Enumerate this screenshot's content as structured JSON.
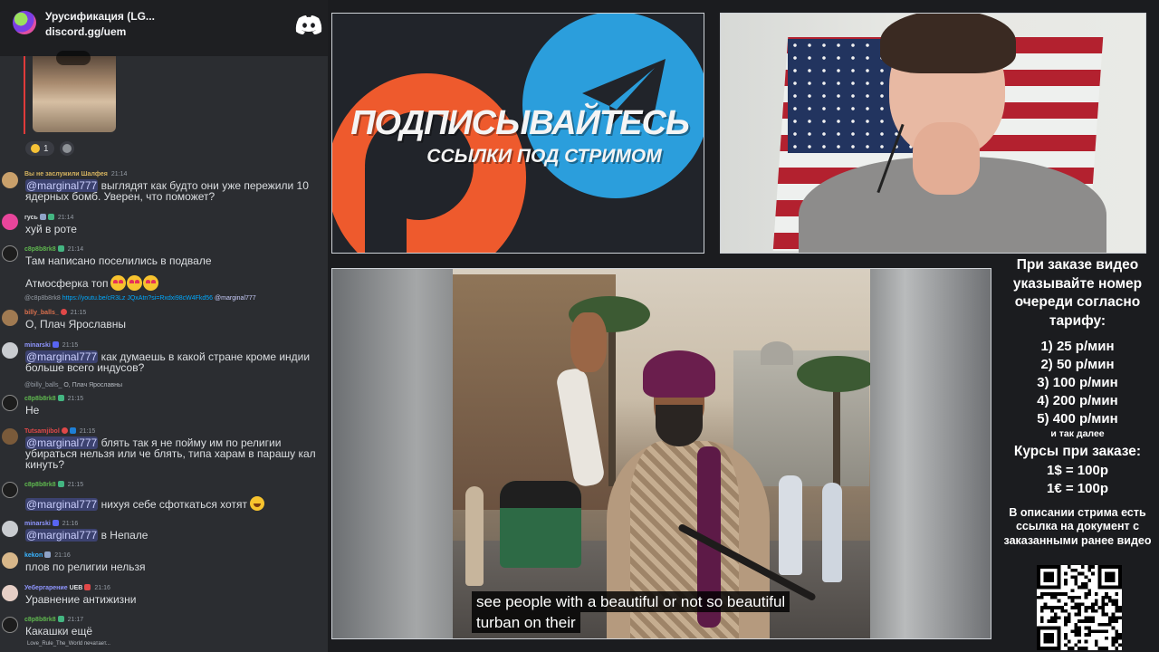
{
  "discord": {
    "server_name": "Урусификация (LG...",
    "invite": "discord.gg/uem",
    "reactions": [
      {
        "count": "1"
      }
    ],
    "messages": [
      {
        "user": "Вы не заслужили Шалфея",
        "time": "21:14",
        "user_color": "#d4b25f",
        "avatar_color": "#c9a06b",
        "text_mention": "@marginal777",
        "text": "выглядят как будто они уже пережили 10 ядерных бомб. Уверен, что поможет?"
      },
      {
        "user": "гусь",
        "time": "21:14",
        "user_color": "#dbdee1",
        "avatar_color": "#e8459b",
        "text": "хуй в роте"
      },
      {
        "user": "c8p8b8rk8",
        "time": "21:14",
        "user_color": "#5fb84f",
        "avatar_color": "#1d1d1d",
        "text": "Там написано поселились в подвале",
        "text2": "Атмосферка топ"
      },
      {
        "reply_user": "@c8p8b8rk8",
        "reply_link": "https://youtu.be/cR3Lz JQxAtn?si=Rxdxi98cW4Fkd56",
        "reply_mention": "@marginal777",
        "user": "billy_balls_",
        "time": "21:15",
        "user_color": "#d9704d",
        "avatar_color": "#a07a52",
        "text": "О, Плач Ярославны"
      },
      {
        "user": "minarski",
        "time": "21:15",
        "user_color": "#8f96ff",
        "avatar_color": "#c9ccd0",
        "text_mention": "@marginal777",
        "text": "как думаешь в какой стране кроме индии больше всего индусов?"
      },
      {
        "reply_user": "@billy_balls_",
        "reply_text": "О, Плач Ярославны",
        "user": "c8p8b8rk8",
        "time": "21:15",
        "user_color": "#5fb84f",
        "avatar_color": "#1d1d1d",
        "text": "Не"
      },
      {
        "user": "Tutsamjibol",
        "time": "21:15",
        "user_color": "#e04848",
        "avatar_color": "#7a5a3a",
        "text_mention": "@marginal777",
        "text": "блять так я не пойму им по религии убираться нельзя или че блять, типа харам в парашу кал кинуть?"
      },
      {
        "user": "c8p8b8rk8",
        "time": "21:15",
        "user_color": "#5fb84f",
        "avatar_color": "#1d1d1d",
        "text_mention": "@marginal777",
        "text": "нихуя себе сфоткаться хотят"
      },
      {
        "user": "minarski",
        "time": "21:16",
        "user_color": "#8f96ff",
        "avatar_color": "#c9ccd0",
        "text_mention": "@marginal777",
        "text": "в Непале"
      },
      {
        "user": "kekon",
        "time": "21:16",
        "user_color": "#3ab4ff",
        "avatar_color": "#d8b78a",
        "text": "плов по религии нельзя"
      },
      {
        "user": "Уебергарение",
        "tag": "UEB",
        "time": "21:16",
        "user_color": "#8f96ff",
        "avatar_color": "#e6cfc6",
        "text": "Уравнение антижизни"
      },
      {
        "user": "c8p8b8rk8",
        "time": "21:17",
        "user_color": "#5fb84f",
        "avatar_color": "#1d1d1d",
        "text": "Какашки ещё"
      }
    ],
    "typing": "Love_Rule_The_World печатает..."
  },
  "promo": {
    "title": "ПОДПИСЫВАЙТЕСЬ",
    "subtitle": "ССЫЛКИ ПОД СТРИМОМ",
    "colors": {
      "boosty": "#ee5a2d",
      "telegram": "#2b9edc"
    }
  },
  "video": {
    "caption_line1": "see people with a beautiful or not so beautiful",
    "caption_line2": "turban on their"
  },
  "info": {
    "order_text": "При заказе видео указывайте номер очереди согласно тарифу:",
    "tariffs": [
      "1) 25 р/мин",
      "2) 50 р/мин",
      "3) 100 р/мин",
      "4) 200 р/мин",
      "5) 400 р/мин"
    ],
    "and_more": "и так далее",
    "rates_title": "Курсы при заказе:",
    "rates": [
      "1$ = 100р",
      "1€ = 100р"
    ],
    "description": "В описании стрима есть ссылка на документ с заказанными ранее видео"
  }
}
